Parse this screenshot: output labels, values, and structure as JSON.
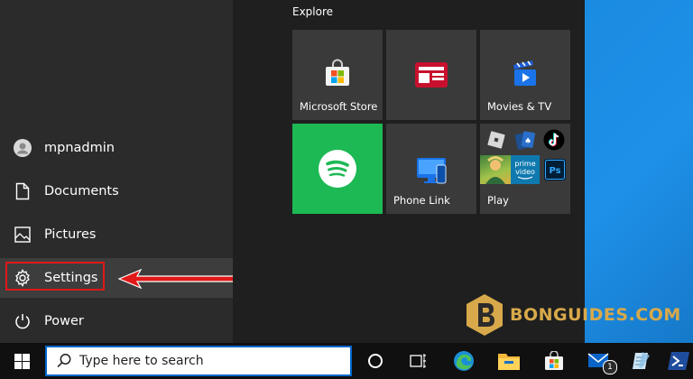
{
  "sidebar": {
    "user": "mpnadmin",
    "documents": "Documents",
    "pictures": "Pictures",
    "settings": "Settings",
    "power": "Power"
  },
  "tiles": {
    "group_label": "Explore",
    "microsoft_store": "Microsoft Store",
    "movies_tv": "Movies & TV",
    "phone_link": "Phone Link",
    "play": "Play",
    "prime_video": "prime video"
  },
  "taskbar": {
    "search_placeholder": "Type here to search",
    "mail_badge": "1"
  },
  "watermark": {
    "text": "BONGUIDES.COM"
  },
  "colors": {
    "spotify": "#1db954",
    "highlight": "#e01818",
    "accent": "#0078d7",
    "watermark": "#d8a94a"
  }
}
